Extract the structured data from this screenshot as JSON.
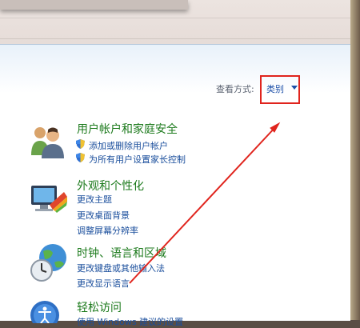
{
  "view_by": {
    "label": "查看方式:",
    "value": "类别"
  },
  "categories": [
    {
      "title": "用户帐户和家庭安全",
      "icon": "users-icon",
      "links": [
        "添加或删除用户帐户",
        "为所有用户设置家长控制"
      ]
    },
    {
      "title": "外观和个性化",
      "icon": "appearance-icon",
      "links": [
        "更改主题",
        "更改桌面背景",
        "调整屏幕分辨率"
      ]
    },
    {
      "title": "时钟、语言和区域",
      "icon": "clock-globe-icon",
      "links": [
        "更改键盘或其他输入法",
        "更改显示语言"
      ]
    },
    {
      "title": "轻松访问",
      "icon": "ease-of-access-icon",
      "links": [
        "使用 Windows 建议的设置"
      ]
    }
  ],
  "colors": {
    "annotation": "#e0241d",
    "title": "#1c7a1c",
    "link": "#1a4e9c"
  }
}
